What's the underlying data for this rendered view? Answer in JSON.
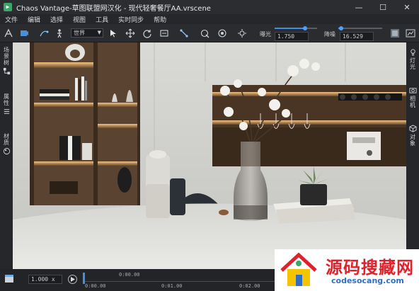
{
  "window": {
    "title": "Chaos Vantage-草图联盟网汉化 - 现代轻奢餐厅AA.vrscene",
    "controls": {
      "minimize": "—",
      "maximize": "☐",
      "close": "✕"
    }
  },
  "menu": [
    "文件",
    "编辑",
    "选择",
    "视图",
    "工具",
    "实时同步",
    "帮助"
  ],
  "toolbar": {
    "view_select": "世界",
    "exposure_label": "曝光",
    "exposure_value": "1.750",
    "exposure_fraction": 0.72,
    "denoise_label": "降噪",
    "denoise_value": "16.529",
    "denoise_fraction": 0.06,
    "icons": [
      "navigate-icon",
      "walk-camera-icon",
      "path-icon",
      "person-icon",
      "cursor-icon",
      "move-icon",
      "rotate-icon",
      "sync-icon",
      "pick-icon",
      "material-brush-icon",
      "lens-icon",
      "focus-icon",
      "snapshot-icon",
      "render-icon"
    ]
  },
  "left_panel": {
    "tabs": [
      {
        "label": "场景树",
        "icon": "scene-tree-icon"
      },
      {
        "label": "属性",
        "icon": "properties-icon"
      },
      {
        "label": "材质",
        "icon": "material-icon"
      }
    ]
  },
  "right_panel": {
    "tabs": [
      {
        "label": "灯光",
        "icon": "light-icon"
      },
      {
        "label": "相机",
        "icon": "camera-icon"
      },
      {
        "label": "对象",
        "icon": "object-icon"
      }
    ]
  },
  "timeline": {
    "speed": "1.000 x",
    "top_time": "0:00.00",
    "ticks": [
      "0:00.00",
      "0:01.00",
      "0:02.00"
    ]
  },
  "watermark": {
    "title": "源码搜藏网",
    "url": "codesocang.com"
  },
  "colors": {
    "accent": "#3f8ee8",
    "watermark_red": "#e0212b",
    "watermark_blue": "#2e6fc4"
  }
}
